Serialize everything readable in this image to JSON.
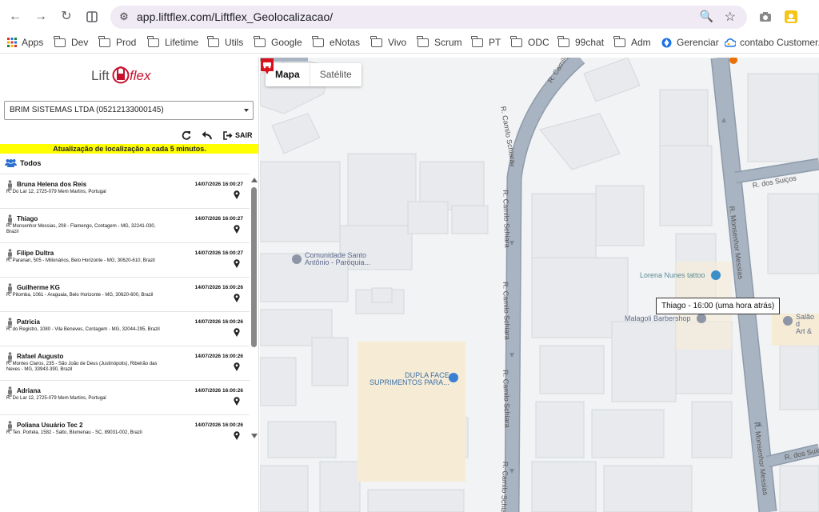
{
  "browser": {
    "url": "app.liftflex.com/Liftflex_Geolocalizacao/",
    "bookmarks": [
      "Apps",
      "Dev",
      "Prod",
      "Lifetime",
      "Utils",
      "Google",
      "eNotas",
      "Vivo",
      "Scrum",
      "PT",
      "ODC",
      "99chat",
      "Adm",
      "Gerenciar",
      "contabo Customer..."
    ]
  },
  "app": {
    "logo_text_left": "Lift",
    "logo_text_right": "flex",
    "company_select": "BRIM SISTEMAS LTDA (05212133000145)",
    "logout_label": "SAIR",
    "update_banner": "Atualização de localização a cada 5 minutos.",
    "all_label": "Todos",
    "people": [
      {
        "name": "Bruna Helena dos Reis",
        "time": "14/07/2026 16:00:27",
        "address": "R. Do Lar 12, 2725-079 Mem Martins, Portugal"
      },
      {
        "name": "Thiago",
        "time": "14/07/2026 16:00:27",
        "address": "R. Monsenhor Messias, 208 - Flamengo, Contagem - MG, 32241-030, Brazil"
      },
      {
        "name": "Filipe Dultra",
        "time": "14/07/2026 16:00:27",
        "address": "R. Paranan, 505 - Milionários, Belo Horizonte - MG, 30620-610, Brazil"
      },
      {
        "name": "Guilherme KG",
        "time": "14/07/2026 16:00:26",
        "address": "R. Pitomba, 1061 - Araguaia, Belo Horizonte - MG, 30620-600, Brazil"
      },
      {
        "name": "Patricia",
        "time": "14/07/2026 16:00:26",
        "address": "R. do Registro, 1080 - Vila Beneves, Contagem - MG, 32044-295, Brazil"
      },
      {
        "name": "Rafael Augusto",
        "time": "14/07/2026 16:00:26",
        "address": "R. Montes Claros, 235 - São João de Deus (Justinópolis), Ribeirão das Neves - MG, 33943-390, Brazil"
      },
      {
        "name": "Adriana",
        "time": "14/07/2026 16:00:26",
        "address": "R. Do Lar 12, 2725-079 Mem Martins, Portugal"
      },
      {
        "name": "Poliana Usuário Tec 2",
        "time": "14/07/2026 16:00:26",
        "address": "R. Ten. Portela, 1582 - Salto, Blumenau - SC, 89031-002, Brazil"
      }
    ]
  },
  "map": {
    "type_tabs": [
      "Mapa",
      "Satélite"
    ],
    "streets": [
      "R. Camilo Schiara",
      "R. Camilo Schiara",
      "R. Camilo Schiara",
      "R. Camilo Schiara",
      "R. Camilo Schiara",
      "R. Monsenhor Messias",
      "R. Monsenhor Messias",
      "R. dos Suiços",
      "R. dos Suiços",
      "R. Camilo"
    ],
    "pois": {
      "church_line1": "Comunidade Santo",
      "church_line2": "Antônio - Paróquia...",
      "store_line1": "DUPLA FACE",
      "store_line2": "SUPRIMENTOS PARA...",
      "tattoo": "Lorena Nunes tattoo",
      "barber": "Malagoli Barbershop",
      "salon_line1": "Salão d",
      "salon_line2": "Art &"
    },
    "tooltip": "Thiago - 16:00 (uma hora atrás)",
    "colors": {
      "road": "#a9b4c2",
      "road_edge": "#8e9bab",
      "building": "#e8eaed",
      "building_edge": "#d5d8dc",
      "marker": "#d9111a"
    }
  }
}
